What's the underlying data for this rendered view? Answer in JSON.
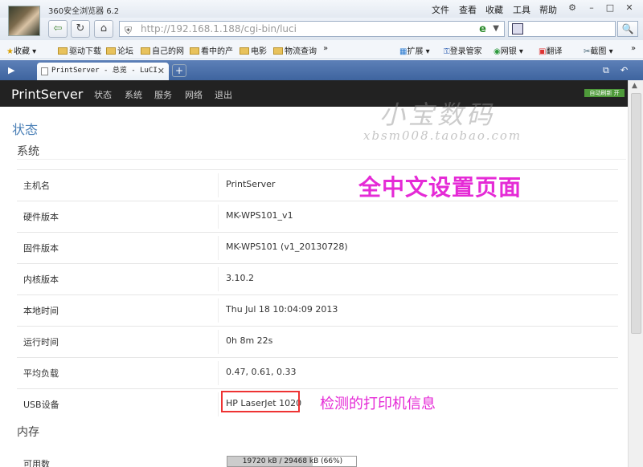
{
  "browser": {
    "title": "360安全浏览器 6.2",
    "menu": [
      "文件",
      "查看",
      "收藏",
      "工具",
      "帮助"
    ],
    "address_host": "http://192.168.1.188",
    "address_path": "/cgi-bin/luci",
    "bookmarks": [
      "收藏",
      "驱动下载",
      "论坛",
      "自己的网",
      "看中的产",
      "电影",
      "物流查询"
    ],
    "extensions": [
      "扩展",
      "登录管家",
      "网银",
      "翻译",
      "截图"
    ],
    "tab_label": "PrintServer - 总览 - LuCI"
  },
  "luci": {
    "brand": "PrintServer",
    "menu": [
      "状态",
      "系统",
      "服务",
      "网络",
      "退出"
    ],
    "auto_refresh": "自动刷新 开",
    "page_title": "状态",
    "section_system": "系统",
    "rows": [
      {
        "key": "主机名",
        "value": "PrintServer"
      },
      {
        "key": "硬件版本",
        "value": "MK-WPS101_v1"
      },
      {
        "key": "固件版本",
        "value": "MK-WPS101 (v1_20130728)"
      },
      {
        "key": "内核版本",
        "value": "3.10.2"
      },
      {
        "key": "本地时间",
        "value": "Thu Jul 18 10:04:09 2013"
      },
      {
        "key": "运行时间",
        "value": "0h 8m 22s"
      },
      {
        "key": "平均负载",
        "value": "0.47, 0.61, 0.33"
      },
      {
        "key": "USB设备",
        "value": "HP LaserJet 1020"
      }
    ],
    "section_memory": "内存",
    "memory": {
      "key": "可用数",
      "value": "19720 kB / 29468 kB (66%)",
      "percent": 66
    }
  },
  "annotations": {
    "main": "全中文设置页面",
    "printer": "检测的打印机信息",
    "watermark": "小宝数码",
    "watermark_url": "xbsm008.taobao.com"
  },
  "colors": {
    "accent": "#4a7fb6",
    "annotation": "#e52ad6",
    "highlight": "#e33333"
  }
}
